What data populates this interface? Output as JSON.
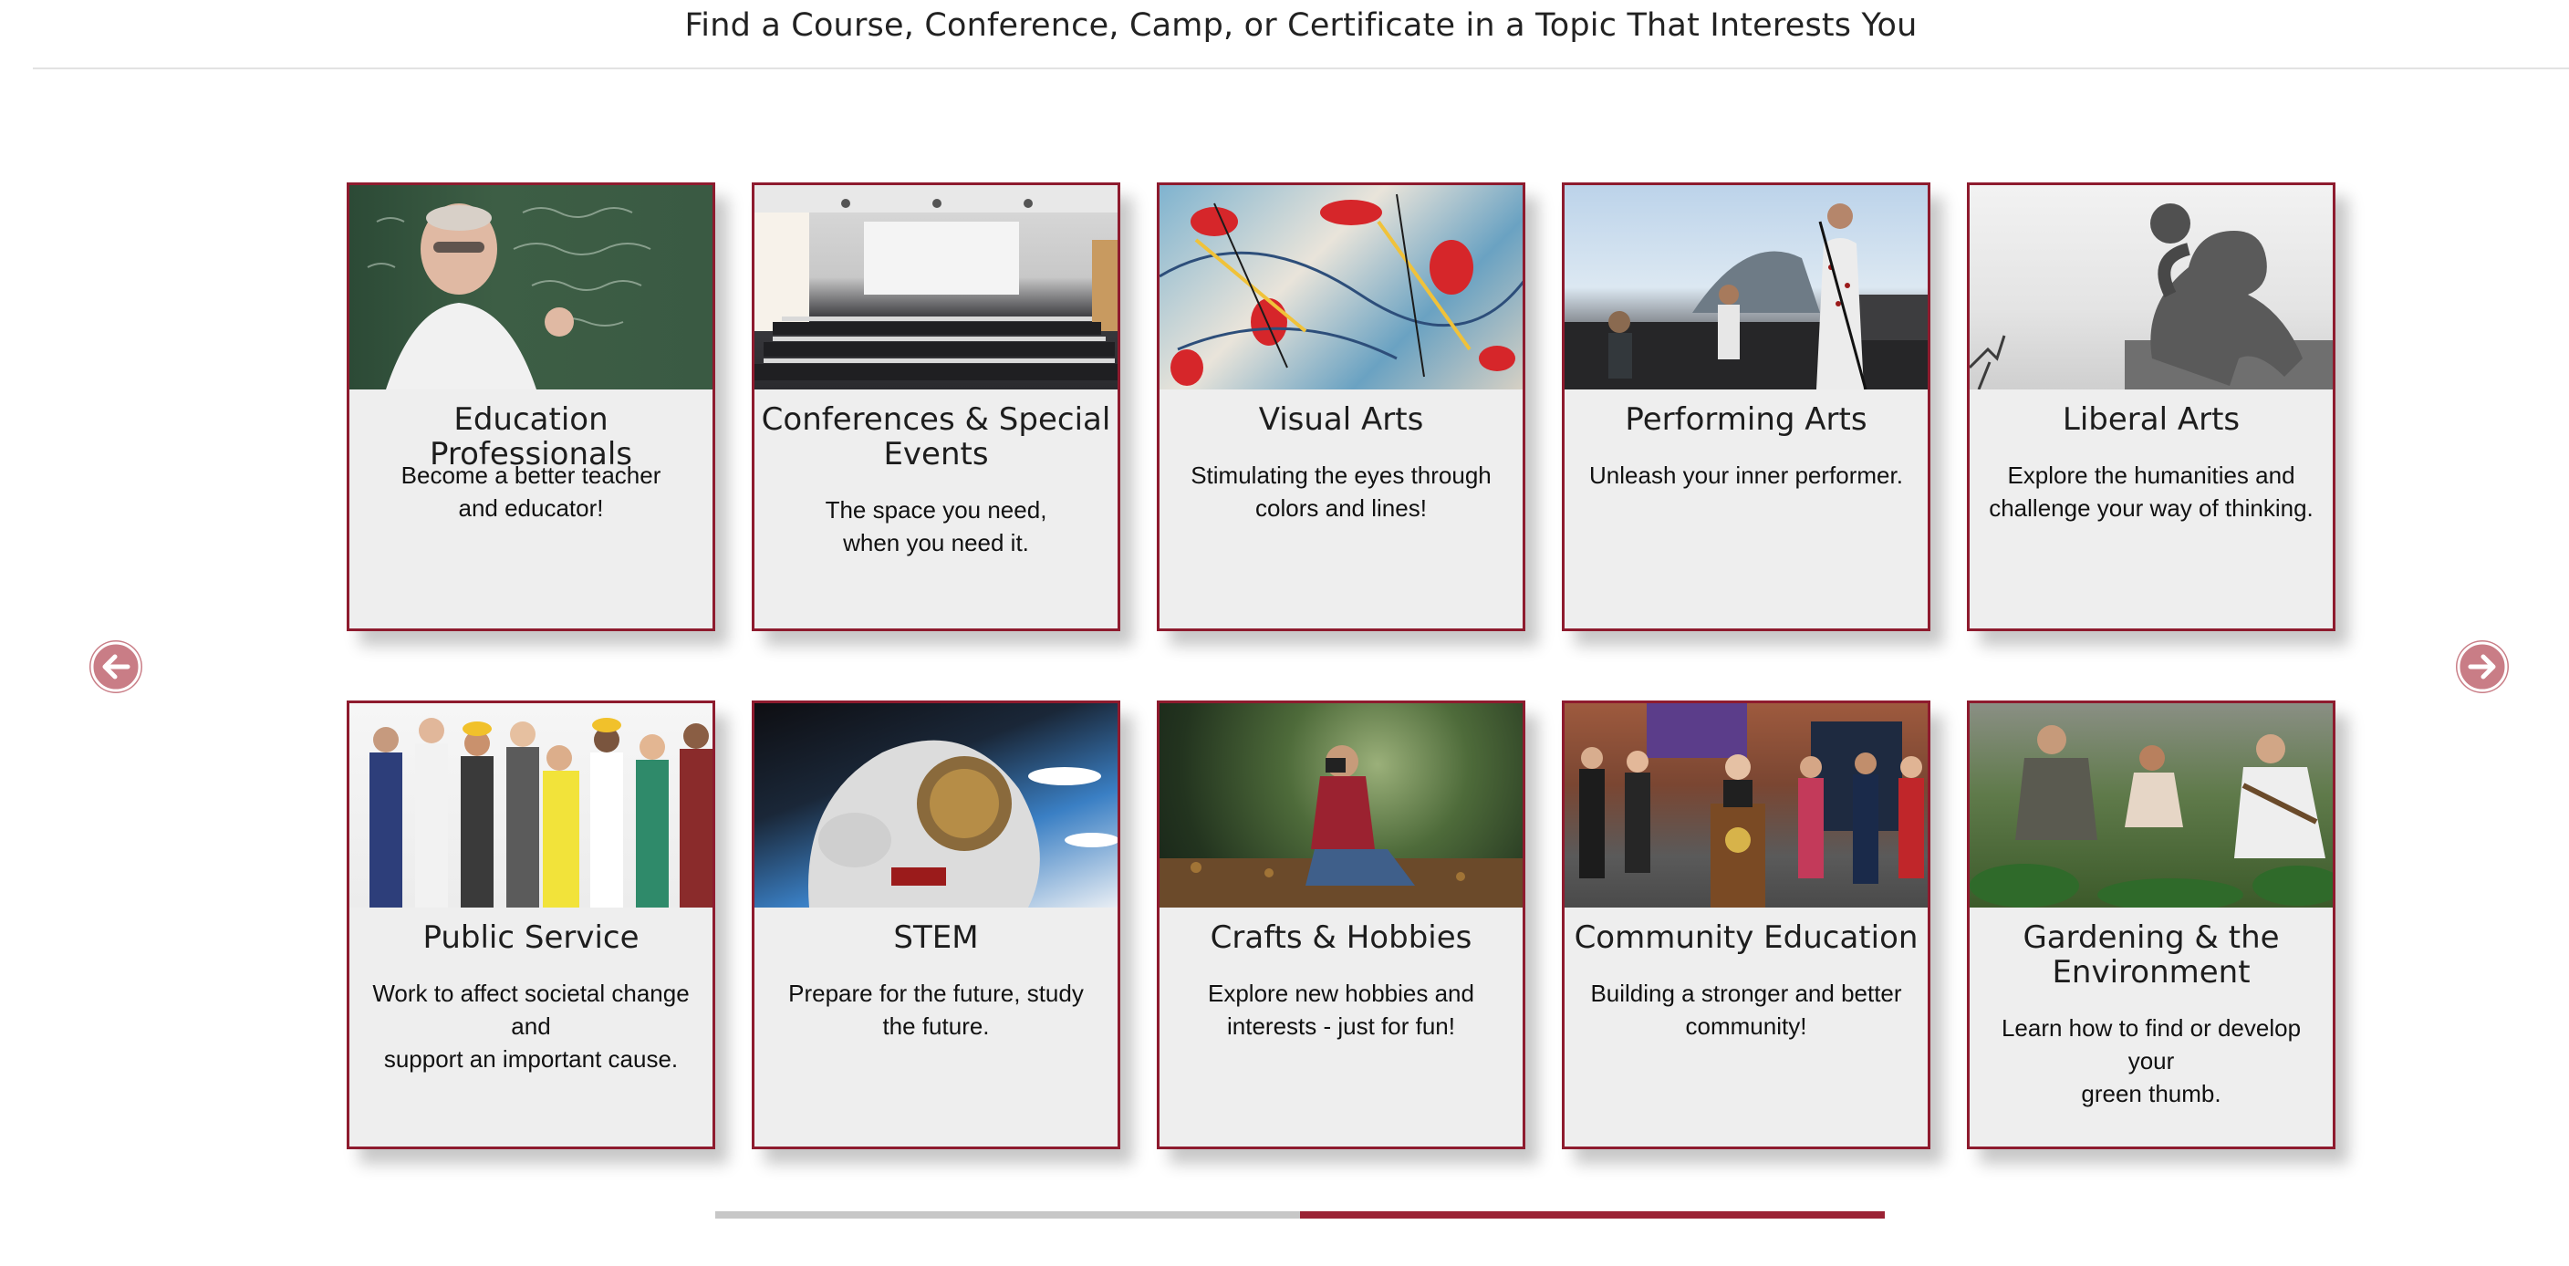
{
  "header": {
    "title": "Find a Course, Conference, Camp, or Certificate in a Topic That Interests You"
  },
  "carousel": {
    "prev_icon": "arrow-left-circle-icon",
    "next_icon": "arrow-right-circle-icon",
    "progress_fraction": 0.5,
    "colors": {
      "border": "#8e1b2e",
      "card_bg": "#eeeeee",
      "arrow": "#c97d86",
      "progress_fill": "#9b2335",
      "progress_track": "#c7c7c7"
    }
  },
  "cards": [
    {
      "title": "Education Professionals",
      "desc_line1": "Become a better teacher",
      "desc_line2": "and educator!",
      "image": "teacher-chalkboard-photo"
    },
    {
      "title": "Conferences & Special Events",
      "desc_line1": "The space you need,",
      "desc_line2": "when you need it.",
      "image": "conference-hall-photo"
    },
    {
      "title": "Visual Arts",
      "desc_line1": "Stimulating the eyes through",
      "desc_line2": "colors and lines!",
      "image": "abstract-paint-photo"
    },
    {
      "title": "Performing Arts",
      "desc_line1": "Unleash your inner performer.",
      "desc_line2": "",
      "image": "concert-stage-photo"
    },
    {
      "title": "Liberal Arts",
      "desc_line1": "Explore the humanities and",
      "desc_line2": "challenge your way of thinking.",
      "image": "thinker-statue-photo"
    },
    {
      "title": "Public Service",
      "desc_line1": "Work to affect societal change and",
      "desc_line2": "support an important cause.",
      "image": "professionals-group-photo"
    },
    {
      "title": "STEM",
      "desc_line1": "Prepare for the future, study",
      "desc_line2": "the future.",
      "image": "astronaut-photo"
    },
    {
      "title": "Crafts & Hobbies",
      "desc_line1": "Explore new hobbies and",
      "desc_line2": "interests - just for fun!",
      "image": "photographer-forest-photo"
    },
    {
      "title": "Community Education",
      "desc_line1": "Building a stronger and better",
      "desc_line2": "community!",
      "image": "podium-speech-photo"
    },
    {
      "title": "Gardening & the Environment",
      "desc_line1": "Learn how to find or develop your",
      "desc_line2": "green thumb.",
      "image": "gardening-photo"
    }
  ]
}
